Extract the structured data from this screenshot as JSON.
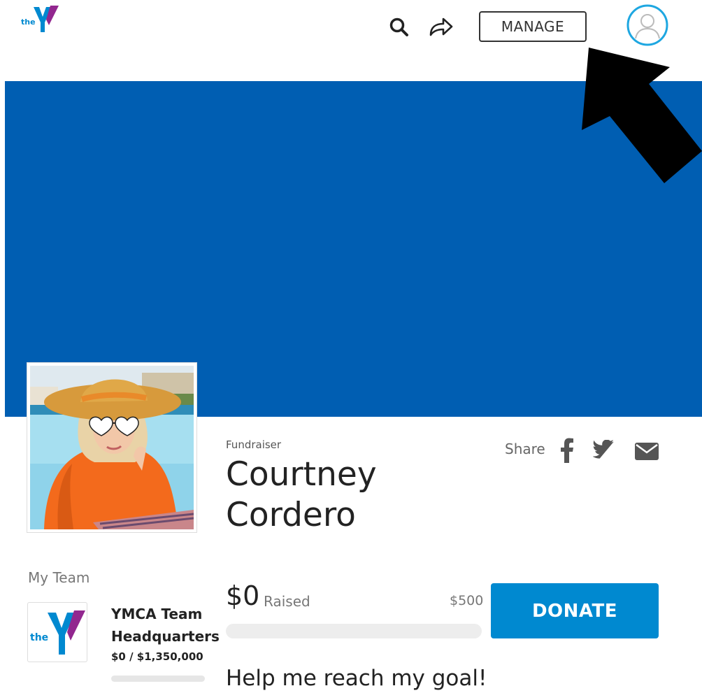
{
  "colors": {
    "brand": "#005EB2",
    "accent": "#0089D0",
    "purple": "#92278F"
  },
  "header": {
    "logo_text": "the",
    "logo_icon": "ymca-logo",
    "icons": [
      "search-icon",
      "share-arrow-icon",
      "user-avatar-icon"
    ],
    "manage_label": "MANAGE"
  },
  "fundraiser": {
    "label": "Fundraiser",
    "name": "Courtney Cordero",
    "share_label": "Share",
    "share_icons": [
      "facebook-icon",
      "twitter-icon",
      "email-icon"
    ]
  },
  "team": {
    "heading": "My Team",
    "logo_text": "the",
    "name": "YMCA Team Headquarters",
    "amount": "$0 / $1,350,000",
    "progress": 0
  },
  "donation": {
    "raised": "$0",
    "raised_label": "Raised",
    "goal": "$500",
    "progress": 0,
    "donate_label": "DONATE",
    "tagline": "Help me reach my goal!"
  }
}
